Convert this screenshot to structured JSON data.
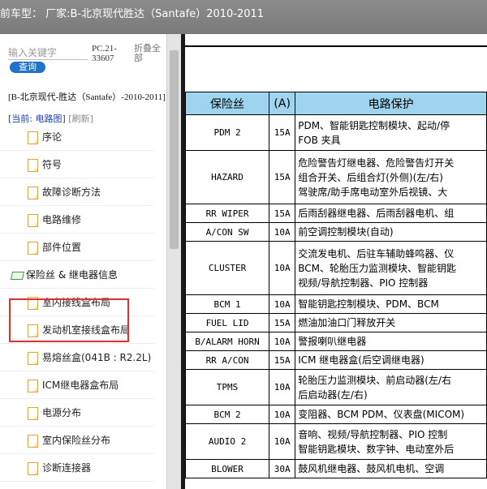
{
  "window": {
    "title": "前车型：  厂家:B-北京现代胜达（Santafe）2010-2011"
  },
  "sidebar": {
    "search_placeholder": "输入关键字",
    "query_button": "查询",
    "pc_code": "PC.21-33607",
    "collapse_all": "折叠全部",
    "model_info": "[B-北京现代-胜达（Santafe）-2010-2011]",
    "current_label": "[当前: 电路图]",
    "refresh_label": "[刷新]",
    "items": [
      {
        "label": "序论",
        "icon": "doc-icon"
      },
      {
        "label": "符号",
        "icon": "doc-icon"
      },
      {
        "label": "故障诊断方法",
        "icon": "doc-icon"
      },
      {
        "label": "电路维修",
        "icon": "doc-icon"
      },
      {
        "label": "部件位置",
        "icon": "doc-icon"
      },
      {
        "label": "保险丝 & 继电器信息",
        "icon": "folder-open-icon"
      },
      {
        "label": "室内接线盒布局",
        "icon": "doc-icon"
      },
      {
        "label": "发动机室接线盒布局",
        "icon": "doc-icon"
      },
      {
        "label": "易熔丝盒(041B : R2.2L)",
        "icon": "doc-icon"
      },
      {
        "label": "ICM继电器盒布局",
        "icon": "doc-icon"
      },
      {
        "label": "电源分布",
        "icon": "doc-icon"
      },
      {
        "label": "室内保险丝分布",
        "icon": "doc-icon"
      },
      {
        "label": "诊断连接器",
        "icon": "doc-icon"
      }
    ]
  },
  "fuse_table": {
    "headers": [
      "保险丝",
      "(A)",
      "电路保护"
    ],
    "rows": [
      {
        "name": "PDM 2",
        "amp": "15A",
        "lines": [
          "PDM、智能钥匙控制模块、起动/停",
          "FOB 夹具"
        ]
      },
      {
        "name": "HAZARD",
        "amp": "15A",
        "lines": [
          "危险警告灯继电器、危险警告灯开关",
          "组合开关、后组合灯(外侧)(左/右)",
          "驾驶席/助手席电动室外后视镜、大"
        ]
      },
      {
        "name": "RR WIPER",
        "amp": "15A",
        "lines": [
          "后雨刮器继电器、后雨刮器电机、组"
        ]
      },
      {
        "name": "A/CON SW",
        "amp": "10A",
        "lines": [
          "前空调控制模块(自动)"
        ]
      },
      {
        "name": "CLUSTER",
        "amp": "10A",
        "lines": [
          "交流发电机、后驻车辅助蜂鸣器、仪",
          "BCM、轮胎压力监测模块、智能钥匙",
          "视频/导航控制器、PIO 控制器"
        ]
      },
      {
        "name": "BCM 1",
        "amp": "10A",
        "lines": [
          "智能钥匙控制模块、PDM、BCM"
        ]
      },
      {
        "name": "FUEL LID",
        "amp": "15A",
        "lines": [
          "燃油加油口门释放开关"
        ]
      },
      {
        "name": "B/ALARM HORN",
        "amp": "10A",
        "lines": [
          "警报喇叭继电器"
        ]
      },
      {
        "name": "RR A/CON",
        "amp": "15A",
        "lines": [
          "ICM 继电器盒(后空调继电器)"
        ]
      },
      {
        "name": "TPMS",
        "amp": "10A",
        "lines": [
          "轮胎压力监测模块、前启动器(左/右",
          "后启动器(左/右)"
        ]
      },
      {
        "name": "BCM 2",
        "amp": "10A",
        "lines": [
          "变阻器、BCM PDM、仪表盘(MICOM)"
        ]
      },
      {
        "name": "AUDIO 2",
        "amp": "10A",
        "lines": [
          "音响、视频/导航控制器、PIO 控制",
          "智能钥匙模块、数字钟、电动室外后"
        ]
      },
      {
        "name": "BLOWER",
        "amp": "30A",
        "lines": [
          "鼓风机继电器、鼓风机电机、空调"
        ]
      }
    ]
  }
}
